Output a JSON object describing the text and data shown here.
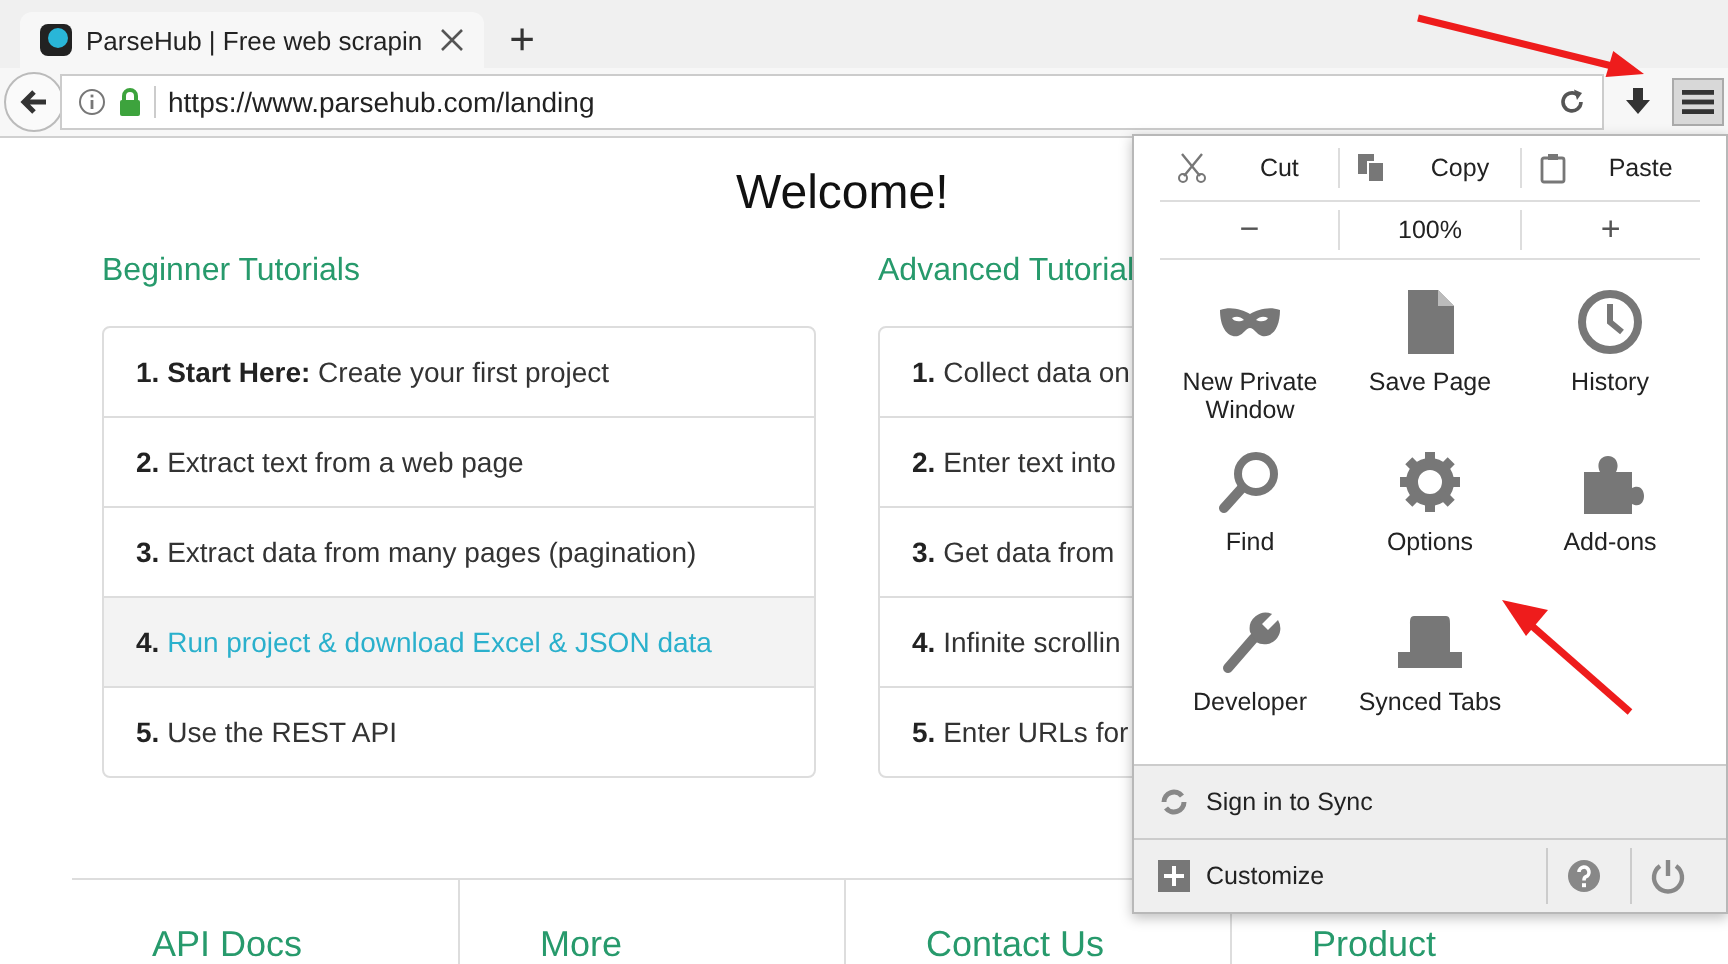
{
  "browser": {
    "tab": {
      "title": "ParseHub | Free web scrapin",
      "selected": true
    },
    "new_tab": "+",
    "url": "https://www.parsehub.com/landing",
    "menu_button": {
      "pressed": true
    }
  },
  "page": {
    "title": "Welcome!",
    "sections": [
      {
        "heading": "Beginner Tutorials",
        "items": [
          {
            "text": "**1. Start Here:** Create your first project",
            "selected": false
          },
          {
            "text": "**2.** Extract text from a web page",
            "selected": false
          },
          {
            "text": "**3.** Extract data from many pages (pagination)",
            "selected": false
          },
          {
            "text": "**4.** Run project & download Excel & JSON data",
            "selected": true
          },
          {
            "text": "**5.** Use the REST API",
            "selected": false
          }
        ]
      },
      {
        "heading": "Advanced Tutorial",
        "items": [
          {
            "text": "**1.** Collect data on",
            "selected": false
          },
          {
            "text": "**2.** Enter text into",
            "selected": false
          },
          {
            "text": "**3.** Get data from",
            "selected": false
          },
          {
            "text": "**4.** Infinite scrollin",
            "selected": false
          },
          {
            "text": "**5.** Enter URLs for",
            "selected": false
          }
        ]
      }
    ],
    "footer": [
      "API Docs",
      "More",
      "Contact Us",
      "Product"
    ]
  },
  "menu": {
    "edit": [
      {
        "label": "Cut",
        "kind": "cut"
      },
      {
        "label": "Copy",
        "kind": "copy"
      },
      {
        "label": "Paste",
        "kind": "paste"
      }
    ],
    "zoom": {
      "out": "−",
      "level": "100%",
      "in": "+"
    },
    "items": [
      {
        "label": "New Private Window",
        "kind": "mask"
      },
      {
        "label": "Save Page",
        "kind": "page"
      },
      {
        "label": "History",
        "kind": "clock"
      },
      {
        "label": "Find",
        "kind": "search"
      },
      {
        "label": "Options",
        "kind": "gear"
      },
      {
        "label": "Add-ons",
        "kind": "puzzle"
      },
      {
        "label": "Developer",
        "kind": "wrench"
      },
      {
        "label": "Synced Tabs",
        "kind": "tabs"
      }
    ],
    "sync": "Sign in to Sync",
    "customize": "Customize"
  }
}
